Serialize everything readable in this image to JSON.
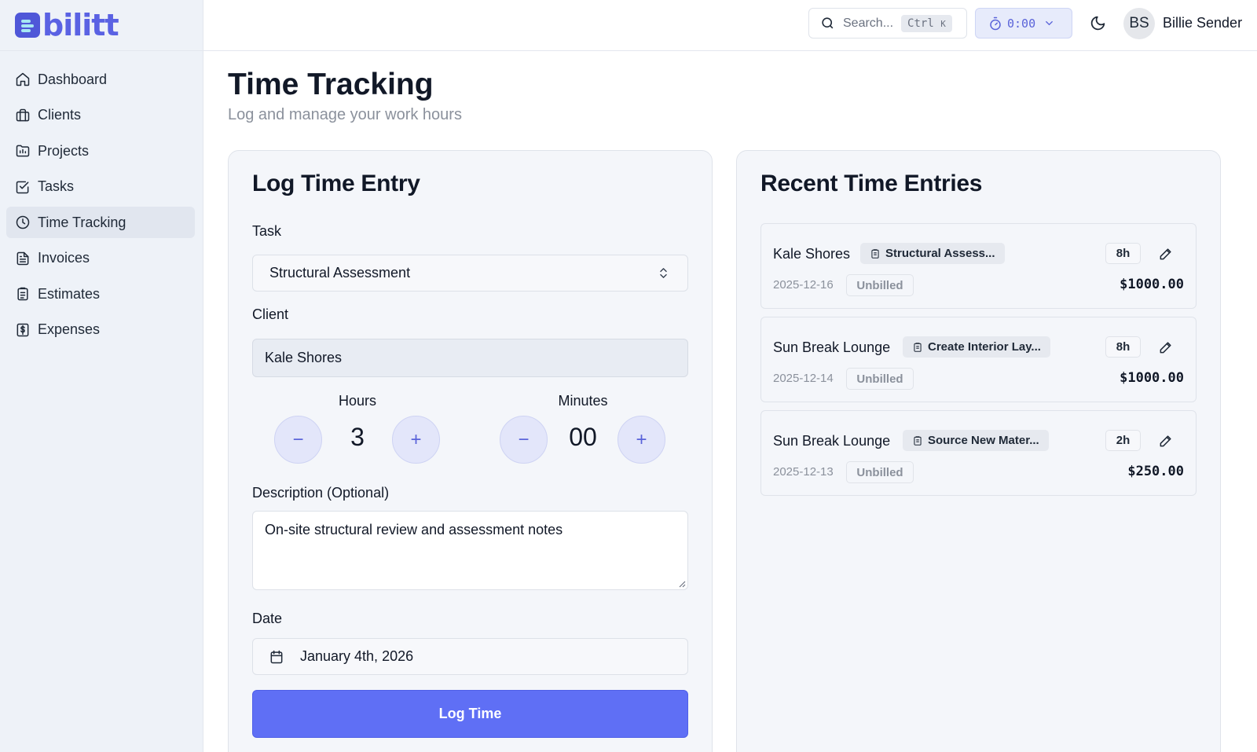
{
  "app": {
    "logo_text": "bilitt"
  },
  "sidebar": {
    "items": [
      {
        "label": "Dashboard",
        "icon": "home-icon"
      },
      {
        "label": "Clients",
        "icon": "briefcase-icon"
      },
      {
        "label": "Projects",
        "icon": "folder-chart-icon"
      },
      {
        "label": "Tasks",
        "icon": "checkbox-icon"
      },
      {
        "label": "Time Tracking",
        "icon": "clock-icon",
        "active": true
      },
      {
        "label": "Invoices",
        "icon": "document-icon"
      },
      {
        "label": "Estimates",
        "icon": "clipboard-icon"
      },
      {
        "label": "Expenses",
        "icon": "dollar-receipt-icon"
      }
    ]
  },
  "topbar": {
    "search_placeholder": "Search...",
    "search_shortcut_key": "Ctrl",
    "search_shortcut_letter": "K",
    "timer_value": "0:00",
    "user_initials": "BS",
    "user_name": "Billie Sender"
  },
  "header": {
    "title": "Time Tracking",
    "subtitle": "Log and manage your work hours"
  },
  "log_form": {
    "title": "Log Time Entry",
    "task_label": "Task",
    "task_value": "Structural Assessment",
    "client_label": "Client",
    "client_value": "Kale Shores",
    "hours_label": "Hours",
    "hours_value": "3",
    "minutes_label": "Minutes",
    "minutes_value": "00",
    "minus": "−",
    "plus": "+",
    "description_label": "Description (Optional)",
    "description_value": "On-site structural review and assessment notes",
    "date_label": "Date",
    "date_value": "January 4th, 2026",
    "submit_label": "Log Time"
  },
  "recent": {
    "title": "Recent Time Entries",
    "entries": [
      {
        "client": "Kale Shores",
        "task": "Structural Assess...",
        "hours": "8h",
        "date": "2025-12-16",
        "status": "Unbilled",
        "amount": "$1000.00"
      },
      {
        "client": "Sun Break Lounge",
        "task": "Create Interior Lay...",
        "hours": "8h",
        "date": "2025-12-14",
        "status": "Unbilled",
        "amount": "$1000.00"
      },
      {
        "client": "Sun Break Lounge",
        "task": "Source New Mater...",
        "hours": "2h",
        "date": "2025-12-13",
        "status": "Unbilled",
        "amount": "$250.00"
      }
    ]
  },
  "colors": {
    "accent": "#5f6ff5",
    "sidebar_bg": "#eef2f8",
    "card_bg": "#f4f6fa"
  }
}
